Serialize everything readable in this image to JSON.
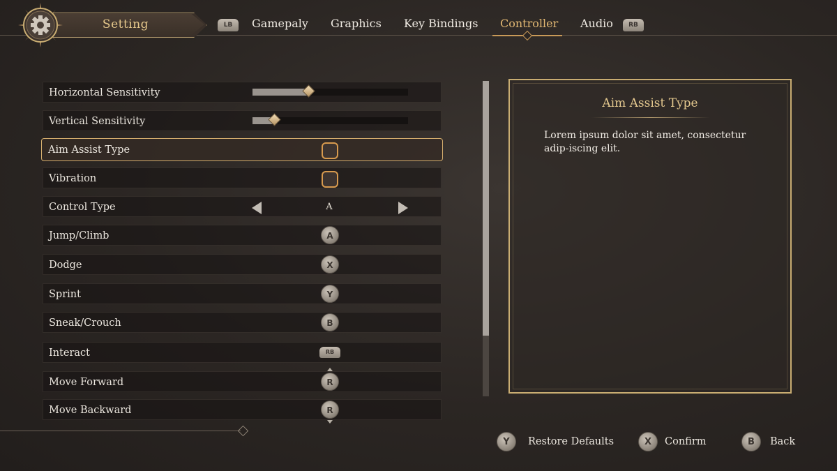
{
  "header": {
    "title": "Setting",
    "lb_label": "LB",
    "rb_label": "RB",
    "tabs": [
      {
        "label": "Gamepaly",
        "active": false
      },
      {
        "label": "Graphics",
        "active": false
      },
      {
        "label": "Key Bindings",
        "active": false
      },
      {
        "label": "Controller",
        "active": true
      },
      {
        "label": "Audio",
        "active": false
      }
    ]
  },
  "settings": [
    {
      "label": "Horizontal Sensitivity",
      "type": "slider",
      "value": 0.36
    },
    {
      "label": "Vertical Sensitivity",
      "type": "slider",
      "value": 0.14
    },
    {
      "label": "Aim Assist Type",
      "type": "checkbox",
      "checked": false,
      "selected": true
    },
    {
      "label": "Vibration",
      "type": "checkbox",
      "checked": false
    },
    {
      "label": "Control Type",
      "type": "option",
      "value": "A"
    },
    {
      "label": "Jump/Climb",
      "type": "binding",
      "button": "A"
    },
    {
      "label": "Dodge",
      "type": "binding",
      "button": "X"
    },
    {
      "label": "Sprint",
      "type": "binding",
      "button": "Y"
    },
    {
      "label": "Sneak/Crouch",
      "type": "binding",
      "button": "B"
    },
    {
      "label": "Interact",
      "type": "binding",
      "button": "RB"
    },
    {
      "label": "Move Forward",
      "type": "binding",
      "button": "R"
    },
    {
      "label": "Move Backward",
      "type": "binding",
      "button": "R"
    }
  ],
  "detail": {
    "title": "Aim Assist Type",
    "description": "Lorem ipsum dolor sit amet, consectetur adip-iscing elit."
  },
  "footer": {
    "prompts": [
      {
        "button": "Y",
        "label": "Restore Defaults"
      },
      {
        "button": "X",
        "label": "Confirm"
      },
      {
        "button": "B",
        "label": "Back"
      }
    ]
  },
  "colors": {
    "accent": "#e2b873",
    "panel_border": "#c9ad72",
    "checkbox_border": "#d79a4e",
    "background": "#2b2623"
  },
  "icons": {
    "emblem": "gear-emblem-icon",
    "left_arrow": "triangle-left-icon",
    "right_arrow": "triangle-right-icon"
  }
}
